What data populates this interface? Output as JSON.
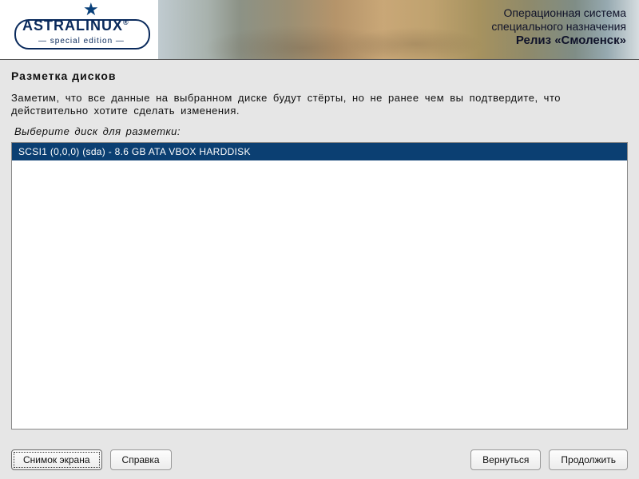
{
  "banner": {
    "logo_name": "ASTRALINUX",
    "logo_sub": "— special edition —",
    "line1": "Операционная система",
    "line2": "специального назначения",
    "line3": "Релиз «Смоленск»"
  },
  "section": {
    "title": "Разметка дисков",
    "description": "Заметим, что все данные на выбранном диске будут стёрты, но не ранее чем вы подтвердите, что действительно хотите сделать изменения.",
    "prompt": "Выберите диск для разметки:"
  },
  "disks": [
    {
      "label": "SCSI1 (0,0,0) (sda) - 8.6 GB ATA VBOX HARDDISK",
      "selected": true
    }
  ],
  "buttons": {
    "screenshot": "Снимок экрана",
    "help": "Справка",
    "back": "Вернуться",
    "continue": "Продолжить"
  }
}
